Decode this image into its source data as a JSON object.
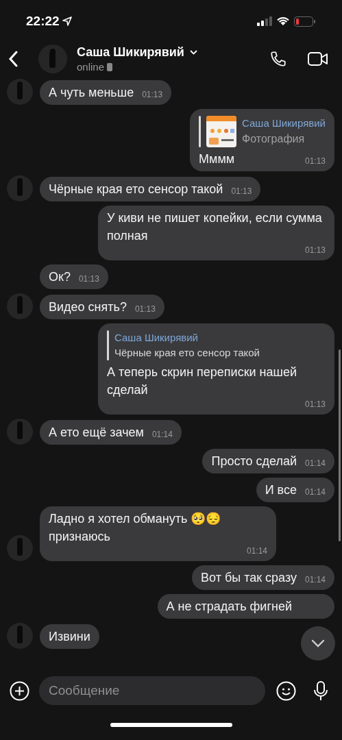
{
  "status_bar": {
    "time": "22:22"
  },
  "header": {
    "name": "Саша Шикирявий",
    "status": "online"
  },
  "messages": [
    {
      "kind": "incoming",
      "avatar": true,
      "text": "А чуть меньше",
      "time": "01:13"
    },
    {
      "kind": "outgoing",
      "reply": {
        "author": "Саша Шикирявий",
        "text": "Фотография"
      },
      "text": "Мммм",
      "time": "01:13"
    },
    {
      "kind": "incoming",
      "avatar": true,
      "text": "Чёрные края ето сенсор такой",
      "time": "01:13"
    },
    {
      "kind": "outgoing",
      "text": "У киви не пишет копейки, если сумма полная",
      "time": "01:13"
    },
    {
      "kind": "incoming",
      "avatar": false,
      "text": "Ок?",
      "time": "01:13"
    },
    {
      "kind": "incoming",
      "avatar": true,
      "text": "Видео снять?",
      "time": "01:13"
    },
    {
      "kind": "outgoing",
      "reply": {
        "kind": "text",
        "author": "Саша Шикирявий",
        "text": "Чёрные края ето сенсор такой"
      },
      "text": "А теперь скрин переписки нашей сделай",
      "time": "01:13"
    },
    {
      "kind": "incoming",
      "avatar": true,
      "text": "А ето ещё зачем",
      "time": "01:14"
    },
    {
      "kind": "outgoing",
      "text": "Просто сделай",
      "time": "01:14"
    },
    {
      "kind": "outgoing",
      "text": "И все",
      "time": "01:14"
    },
    {
      "kind": "incoming",
      "avatar": true,
      "text": "Ладно я хотел обмануть 🥺😔 признаюсь",
      "time": "01:14"
    },
    {
      "kind": "outgoing",
      "text": "Вот бы так сразу",
      "time": "01:14"
    },
    {
      "kind": "outgoing",
      "text": "А не страдать фигней"
    },
    {
      "kind": "incoming",
      "avatar": true,
      "text": "Извини"
    }
  ],
  "composer": {
    "placeholder": "Сообщение"
  }
}
